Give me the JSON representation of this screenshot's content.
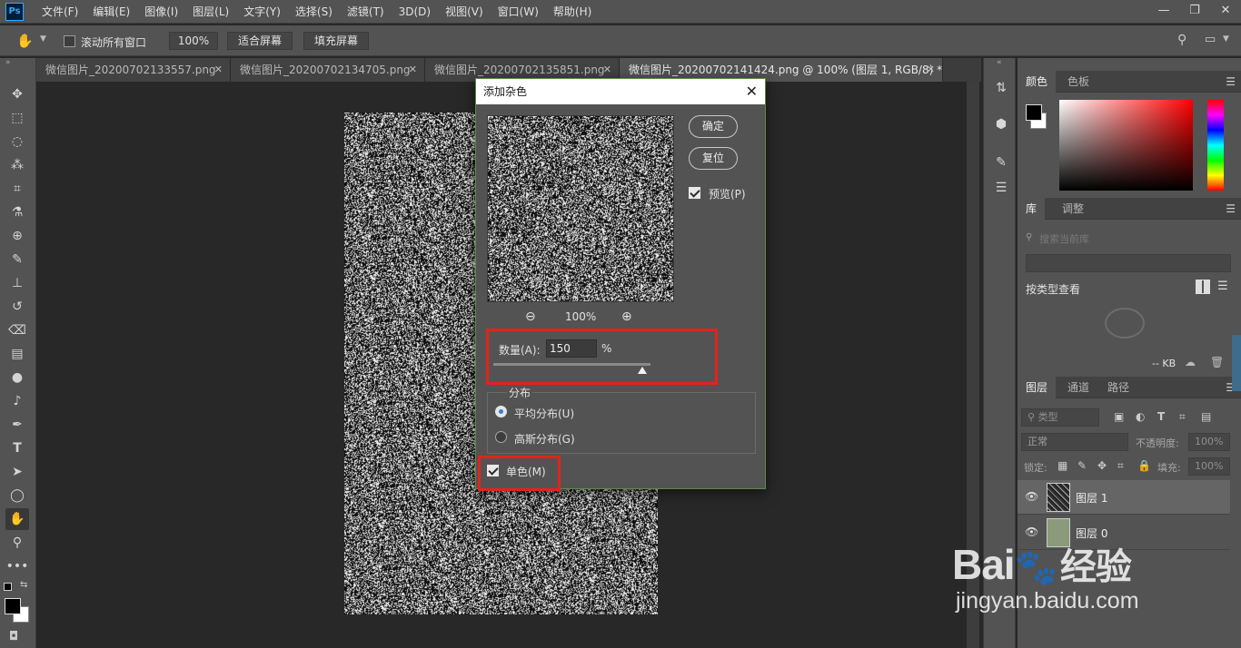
{
  "app": {
    "logo": "Ps"
  },
  "menu": [
    "文件(F)",
    "编辑(E)",
    "图像(I)",
    "图层(L)",
    "文字(Y)",
    "选择(S)",
    "滤镜(T)",
    "3D(D)",
    "视图(V)",
    "窗口(W)",
    "帮助(H)"
  ],
  "options": {
    "scroll_all_label": "滚动所有窗口",
    "zoom_value": "100%",
    "fit_screen": "适合屏幕",
    "fill_screen": "填充屏幕"
  },
  "tabs": [
    {
      "label": "微信图片_20200702133557.png",
      "active": false
    },
    {
      "label": "微信图片_20200702134705.png",
      "active": false
    },
    {
      "label": "微信图片_20200702135851.png",
      "active": false
    },
    {
      "label": "微信图片_20200702141424.png @ 100% (图层 1, RGB/8) *",
      "active": true
    }
  ],
  "dialog": {
    "title": "添加杂色",
    "ok_label": "确定",
    "reset_label": "复位",
    "preview_label": "预览(P)",
    "preview_checked": true,
    "zoom_level": "100%",
    "amount_label": "数量(A):",
    "amount_value": "150",
    "amount_unit": "%",
    "amount_fraction": 0.37,
    "distribution_label": "分布",
    "uniform_label": "平均分布(U)",
    "uniform_checked": true,
    "gaussian_label": "高斯分布(G)",
    "gaussian_checked": false,
    "mono_label": "单色(M)",
    "mono_checked": true
  },
  "panels": {
    "color_tabs": [
      "颜色",
      "色板"
    ],
    "library_tabs": [
      "库",
      "调整"
    ],
    "library_search_placeholder": "搜索当前库",
    "library_view": "按类型查看",
    "library_size": "-- KB",
    "layers_tabs": [
      "图层",
      "通道",
      "路径"
    ],
    "layer_filter": "类型",
    "blend_mode": "正常",
    "opacity_label": "不透明度:",
    "opacity_value": "100%",
    "lock_label": "锁定:",
    "fill_label": "填充:",
    "fill_value": "100%",
    "layers": [
      {
        "name": "图层 1",
        "selected": true
      },
      {
        "name": "图层 0",
        "selected": false
      }
    ]
  },
  "watermark": {
    "brand_text": "Bai",
    "brand_suffix": "经验",
    "url": "jingyan.baidu.com"
  },
  "colors": {
    "accent_red": "#e1241c",
    "chrome": "#535353",
    "canvas_bg": "#282828"
  }
}
